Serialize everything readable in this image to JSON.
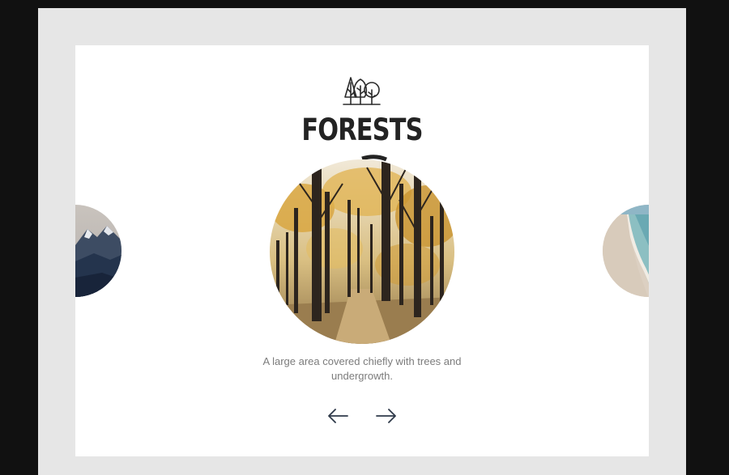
{
  "slide": {
    "icon": "trees-icon",
    "title": "FORESTS",
    "description": "A large area covered chiefly with trees and undergrowth.",
    "image": "forest-photo",
    "accent_color": "#232323"
  },
  "carousel": {
    "prev_icon": "arrow-left-icon",
    "next_icon": "arrow-right-icon",
    "previous_slide_image": "mountain-photo",
    "next_slide_image": "beach-photo"
  },
  "colors": {
    "page_background": "#111111",
    "frame_background": "#e6e6e6",
    "card_background": "#ffffff",
    "description_text": "#7c7c7c"
  }
}
